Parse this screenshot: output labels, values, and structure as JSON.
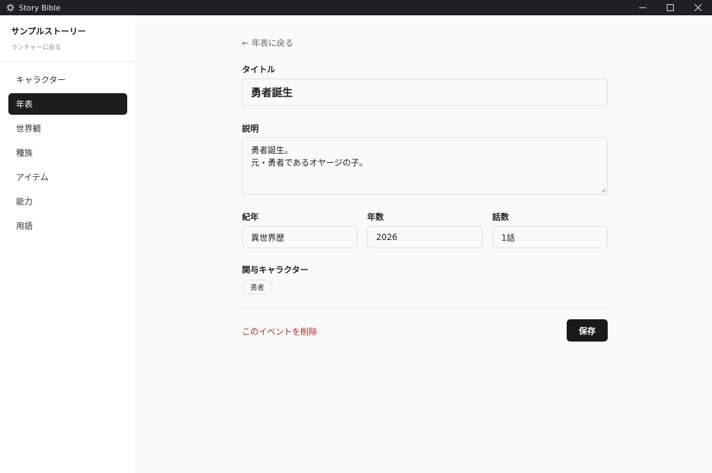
{
  "window": {
    "title": "Story Bible",
    "icon": "gear-app-icon",
    "controls": [
      "minimize-icon",
      "maximize-icon",
      "close-icon"
    ]
  },
  "sidebar": {
    "project_name": "サンプルストーリー",
    "back_to_launcher": "ランチャーに戻る",
    "items": [
      {
        "label": "キャラクター",
        "active": false
      },
      {
        "label": "年表",
        "active": true
      },
      {
        "label": "世界観",
        "active": false
      },
      {
        "label": "種族",
        "active": false
      },
      {
        "label": "アイテム",
        "active": false
      },
      {
        "label": "能力",
        "active": false
      },
      {
        "label": "用語",
        "active": false
      }
    ]
  },
  "main": {
    "back_link": "← 年表に戻る",
    "title_label": "タイトル",
    "title_value": "勇者誕生",
    "description_label": "説明",
    "description_value": "勇者誕生。\n元・勇者であるオヤージの子。",
    "era_label": "紀年",
    "era_value": "異世界歴",
    "year_label": "年数",
    "year_value": "2026",
    "episode_label": "話数",
    "episode_value": "1話",
    "characters_label": "関与キャラクター",
    "characters": [
      "勇者"
    ],
    "delete_label": "このイベントを削除",
    "save_label": "保存"
  },
  "colors": {
    "titlebar": "#1f2023",
    "active_nav": "#1d1d1d",
    "delete": "#b3261e",
    "primary_button": "#1a1a1a"
  }
}
